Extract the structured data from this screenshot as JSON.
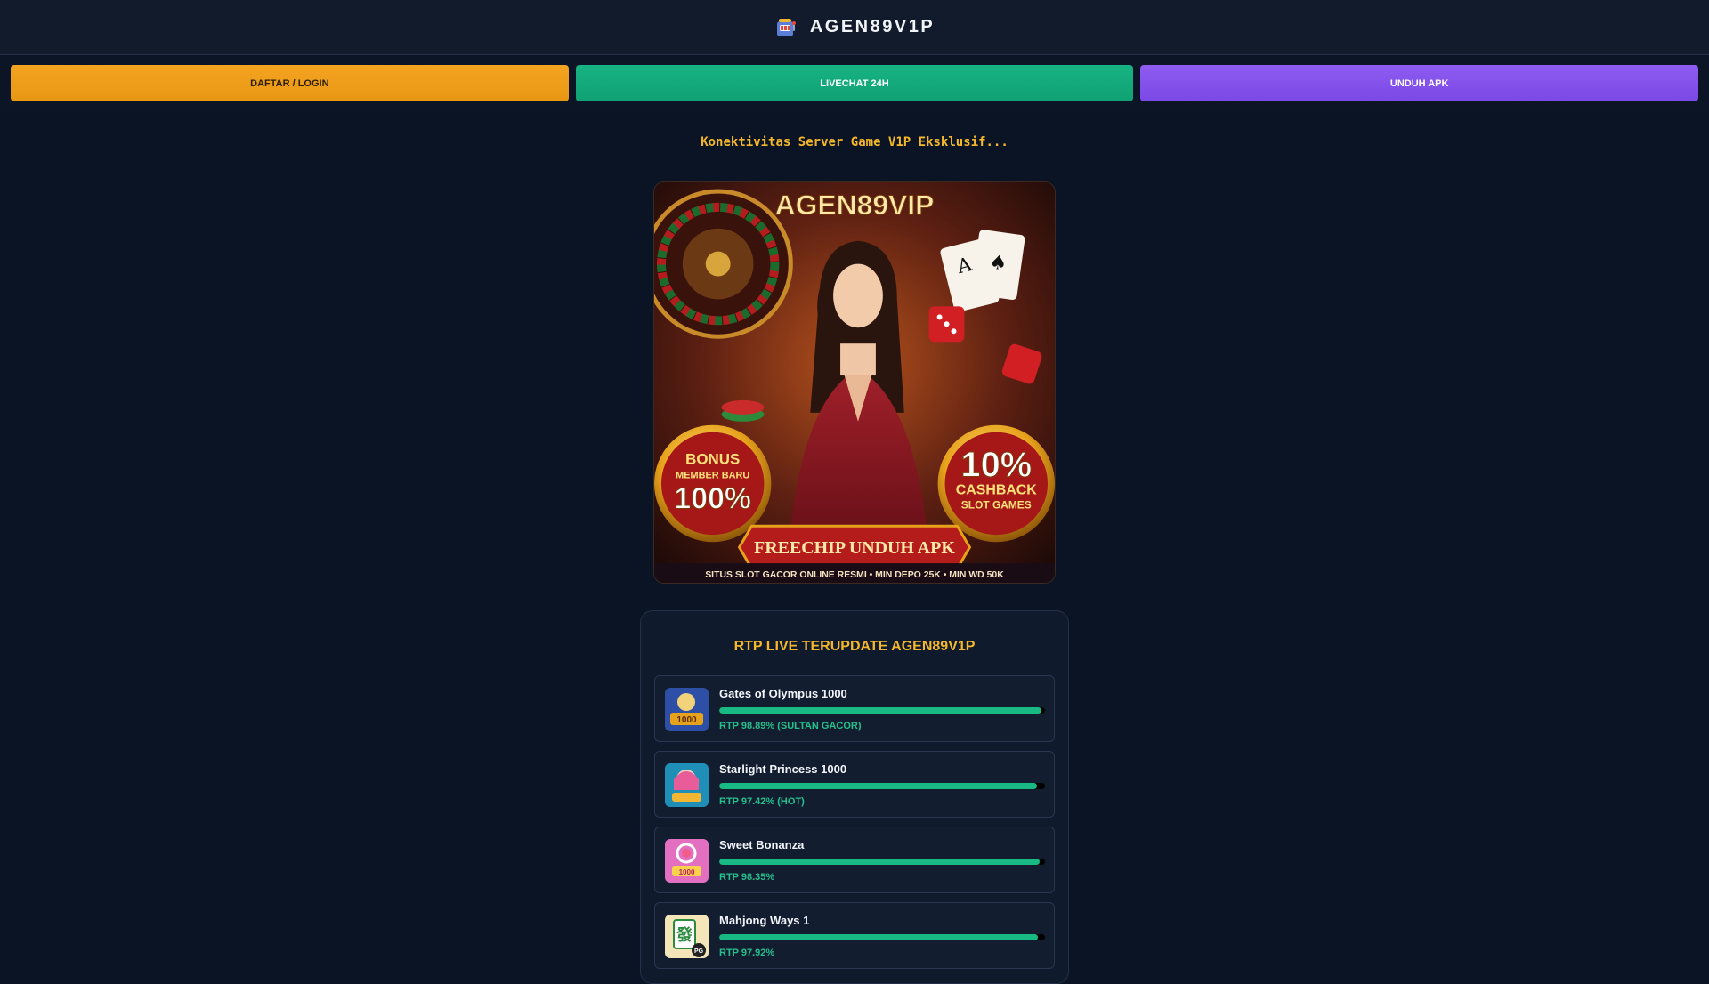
{
  "header": {
    "brand": "AGEN89V1P",
    "logo_icon": "slot-machine-icon"
  },
  "nav": {
    "login_label": "DAFTAR / LOGIN",
    "chat_label": "LIVECHAT 24H",
    "apk_label": "UNDUH APK"
  },
  "tagline": "Konektivitas Server Game V1P Eksklusif...",
  "banner": {
    "brand": "AGEN89VIP",
    "bonus_line1": "BONUS",
    "bonus_line2": "MEMBER BARU",
    "bonus_value": "100%",
    "cashback_value": "10%",
    "cashback_line1": "CASHBACK",
    "cashback_line2": "SLOT GAMES",
    "ribbon": "FREECHIP UNDUH APK",
    "footer": "SITUS SLOT GACOR ONLINE RESMI • MIN DEPO 25K • MIN WD 50K"
  },
  "rtp": {
    "title": "RTP LIVE TERUPDATE AGEN89V1P",
    "games": [
      {
        "name": "Gates of Olympus 1000",
        "rtp_label": "RTP 98.89% (SULTAN GACOR)",
        "rtp": 98.89
      },
      {
        "name": "Starlight Princess 1000",
        "rtp_label": "RTP 97.42% (HOT)",
        "rtp": 97.42
      },
      {
        "name": "Sweet Bonanza",
        "rtp_label": "RTP 98.35%",
        "rtp": 98.35
      },
      {
        "name": "Mahjong Ways 1",
        "rtp_label": "RTP 97.92%",
        "rtp": 97.92
      }
    ]
  },
  "colors": {
    "accent_gold": "#f5b82a",
    "login": "#f4a421",
    "chat": "#17b383",
    "apk": "#8e5cf0",
    "bar": "#19b984"
  }
}
